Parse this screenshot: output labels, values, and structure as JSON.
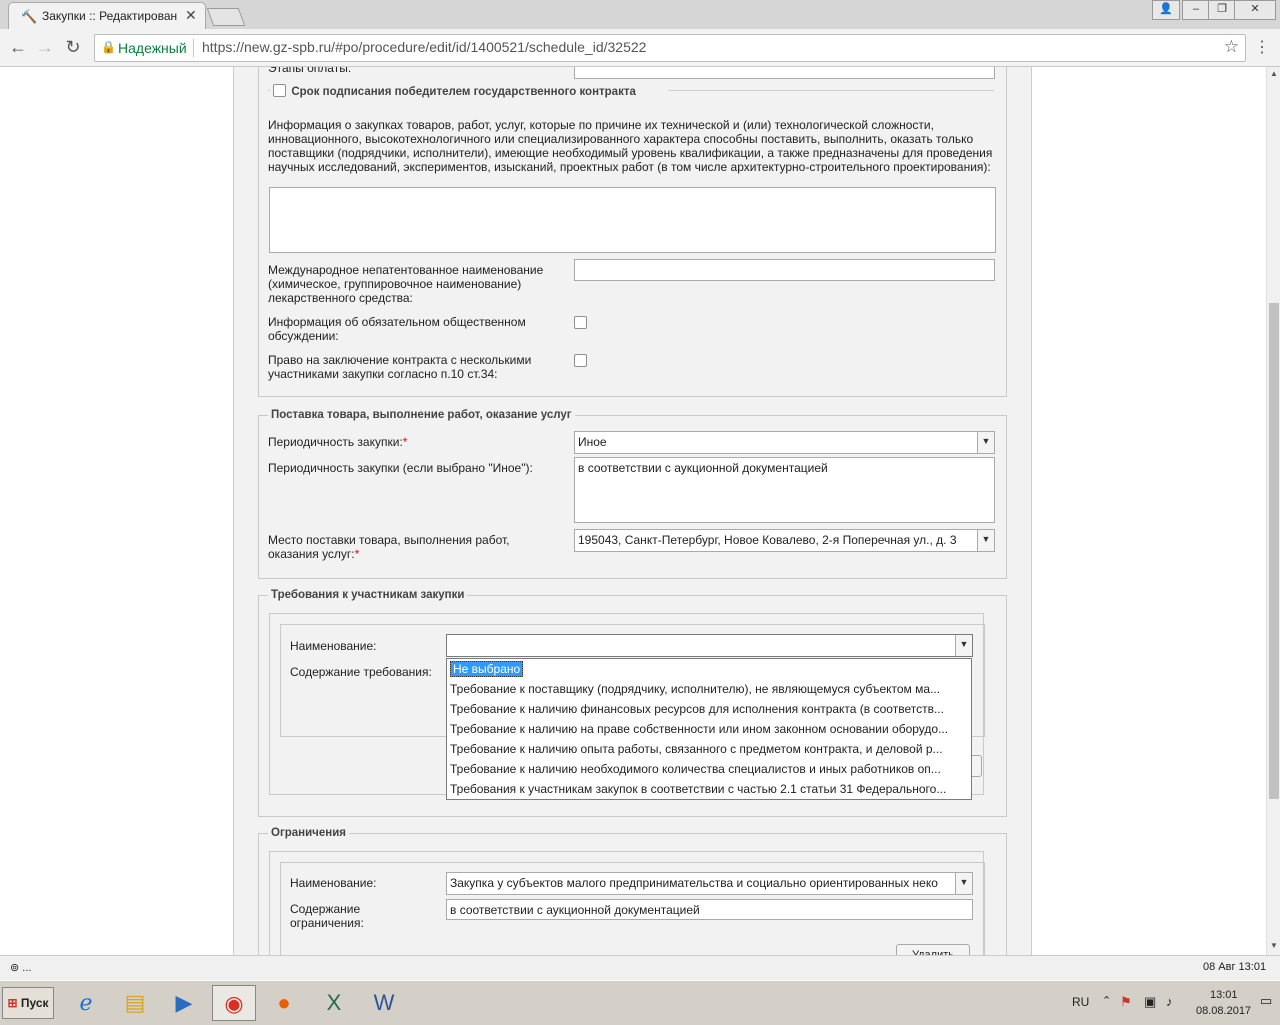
{
  "browser": {
    "tab_title": "Закупки :: Редактирован",
    "tab_close": "✕",
    "secure_label": "Надежный",
    "url": "https://new.gz-spb.ru/#po/procedure/edit/id/1400521/schedule_id/32522"
  },
  "section_top": {
    "payment_stages_label": "Этапы оплаты:",
    "contract_signing_legend": "Срок подписания победителем государственного контракта",
    "special_info_label": "Информация о закупках товаров, работ, услуг, которые по причине их технической и (или) технологической сложности, инновационного, высокотехнологичного или специализированного характера способны поставить, выполнить, оказать только поставщики (подрядчики, исполнители), имеющие необходимый уровень квалификации, а также предназначены для проведения научных исследований, экспериментов, изысканий, проектных работ (в том числе архитектурно-строительного проектирования):",
    "special_info_value": "",
    "inn_label": "Международное непатентованное наименование (химическое, группировочное наименование) лекарственного средства:",
    "inn_value": "",
    "public_discussion_label": "Информация об обязательном общественном обсуждении:",
    "multi_participants_label": "Право на заключение контракта с несколькими участниками закупки согласно п.10 ст.34:"
  },
  "delivery": {
    "legend": "Поставка товара, выполнение работ, оказание услуг",
    "periodicity_label": "Периодичность закупки:",
    "periodicity_value": "Иное",
    "periodicity_other_label": "Периодичность закупки (если выбрано \"Иное\"):",
    "periodicity_other_value": "в соответствии с аукционной документацией",
    "place_label": "Место поставки товара, выполнения работ, оказания услуг:",
    "place_value": "195043, Санкт-Петербург, Новое Ковалево, 2-я Поперечная ул., д. 3"
  },
  "requirements": {
    "legend": "Требования к участникам закупки",
    "name_label": "Наименование:",
    "name_value": "",
    "content_label": "Содержание требования:",
    "options": [
      "Не выбрано",
      "Требование к поставщику (подрядчику, исполнителю), не являющемуся субъектом ма...",
      "Требование к наличию финансовых ресурсов для исполнения контракта (в соответств...",
      "Требование к наличию на праве собственности или ином законном основании оборудо...",
      "Требование к наличию опыта работы, связанного с предметом контракта, и деловой р...",
      "Требование к наличию необходимого количества специалистов и иных работников оп...",
      "Требования к участникам закупок в соответствии с частью 2.1 статьи 31 Федерального..."
    ]
  },
  "restrictions": {
    "legend": "Ограничения",
    "name_label": "Наименование:",
    "name_value": "Закупка у субъектов малого предпринимательства и социально ориентированных неко",
    "content_label": "Содержание ограничения:",
    "content_value": "в соответствии с аукционной документацией",
    "delete_button": "Удалить"
  },
  "statusbar": {
    "status_text": "⊚ ...",
    "datetime": "08 Авг 13:01"
  },
  "taskbar": {
    "start_label": "Пуск",
    "lang": "RU",
    "time": "13:01",
    "date": "08.08.2017"
  }
}
